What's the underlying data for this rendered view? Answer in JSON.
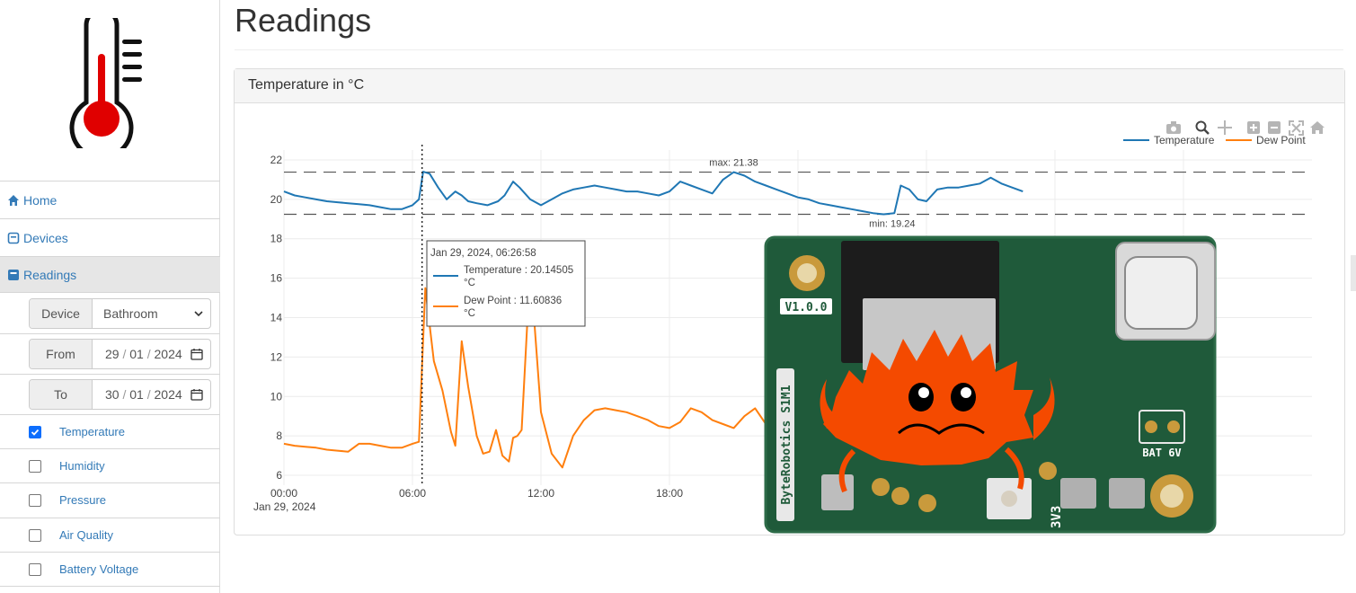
{
  "sidebar": {
    "nav": [
      {
        "label": "Home",
        "icon": "home-icon"
      },
      {
        "label": "Devices",
        "icon": "device-icon"
      },
      {
        "label": "Readings",
        "icon": "readings-icon"
      }
    ],
    "device_label": "Device",
    "device_value": "Bathroom",
    "from_label": "From",
    "from_date": {
      "day": "29",
      "month": "01",
      "year": "2024"
    },
    "to_label": "To",
    "to_date": {
      "day": "30",
      "month": "01",
      "year": "2024"
    },
    "metrics": [
      {
        "label": "Temperature",
        "checked": true
      },
      {
        "label": "Humidity",
        "checked": false
      },
      {
        "label": "Pressure",
        "checked": false
      },
      {
        "label": "Air Quality",
        "checked": false
      },
      {
        "label": "Battery Voltage",
        "checked": false
      }
    ]
  },
  "page": {
    "title": "Readings",
    "panel_title": "Temperature in °C"
  },
  "colors": {
    "temperature": "#1f77b4",
    "dew_point": "#ff7f0e",
    "link": "#337ab7",
    "thermo_red": "#e00000"
  },
  "tooltip": {
    "time": "Jan 29, 2024, 06:26:58",
    "temp_line1": "Temperature : 20.14505",
    "temp_line2": "°C",
    "dew_line1": "Dew Point : 11.60836",
    "dew_line2": "°C"
  },
  "chart_data": {
    "type": "line",
    "title": "",
    "xlabel": "",
    "ylabel": "",
    "ylim": [
      5.5,
      22.5
    ],
    "y_ticks": [
      "22",
      "20",
      "18",
      "16",
      "14",
      "12",
      "10",
      "8",
      "6"
    ],
    "x_ticks": [
      "00:00",
      "06:00",
      "12:00",
      "18:00"
    ],
    "x_date_label": "Jan 29, 2024",
    "legend": [
      "Temperature",
      "Dew Point"
    ],
    "legend_position": "top-right",
    "annotations": {
      "max_label": "max: 21.38",
      "min_label": "min: 19.24",
      "max": 21.38,
      "min": 19.24
    },
    "hover_x_hours": 6.45,
    "series": [
      {
        "name": "Temperature",
        "x_hours": [
          0,
          0.5,
          1,
          1.5,
          2,
          2.5,
          3,
          3.5,
          4,
          4.5,
          5,
          5.5,
          6,
          6.3,
          6.5,
          6.8,
          7.2,
          7.6,
          8,
          8.3,
          8.6,
          9,
          9.5,
          10,
          10.3,
          10.7,
          11,
          11.5,
          12,
          12.5,
          13,
          13.5,
          14,
          14.5,
          15,
          15.5,
          16,
          16.5,
          17,
          17.5,
          18,
          18.5,
          19,
          19.5,
          20,
          20.5,
          21,
          21.5,
          22,
          22.5,
          23,
          23.5,
          24,
          24.5,
          25,
          25.5,
          26,
          26.5,
          27,
          27.5,
          28,
          28.5,
          28.8,
          29.2,
          29.6,
          30,
          30.5,
          31,
          31.5,
          32,
          32.5,
          33,
          33.5,
          34,
          34.5
        ],
        "values": [
          20.4,
          20.2,
          20.1,
          20.0,
          19.9,
          19.85,
          19.8,
          19.75,
          19.7,
          19.6,
          19.5,
          19.5,
          19.7,
          20.0,
          21.4,
          21.3,
          20.6,
          20.0,
          20.4,
          20.2,
          19.9,
          19.8,
          19.7,
          19.9,
          20.2,
          20.9,
          20.6,
          20.0,
          19.7,
          20.0,
          20.3,
          20.5,
          20.6,
          20.7,
          20.6,
          20.5,
          20.4,
          20.4,
          20.3,
          20.2,
          20.4,
          20.9,
          20.7,
          20.5,
          20.3,
          21.0,
          21.38,
          21.2,
          20.9,
          20.7,
          20.5,
          20.3,
          20.1,
          20.0,
          19.8,
          19.7,
          19.6,
          19.5,
          19.4,
          19.3,
          19.24,
          19.3,
          20.7,
          20.5,
          20.0,
          19.9,
          20.5,
          20.6,
          20.6,
          20.7,
          20.8,
          21.1,
          20.8,
          20.6,
          20.4
        ]
      },
      {
        "name": "Dew Point",
        "x_hours": [
          0,
          0.5,
          1,
          1.5,
          2,
          2.5,
          3,
          3.5,
          4,
          4.5,
          5,
          5.5,
          6,
          6.3,
          6.45,
          6.6,
          7,
          7.4,
          7.8,
          8,
          8.3,
          8.6,
          9,
          9.3,
          9.6,
          9.9,
          10.2,
          10.5,
          10.7,
          10.9,
          11.1,
          11.5,
          12,
          12.5,
          13,
          13.5,
          14,
          14.5,
          15,
          15.5,
          16,
          16.5,
          17,
          17.5,
          18,
          18.5,
          19,
          19.5,
          20,
          20.5,
          21,
          21.5,
          22,
          22.5,
          23
        ],
        "values": [
          7.6,
          7.5,
          7.45,
          7.4,
          7.3,
          7.25,
          7.2,
          7.6,
          7.6,
          7.5,
          7.4,
          7.4,
          7.6,
          7.7,
          11.6,
          15.5,
          11.8,
          10.3,
          8.2,
          7.5,
          12.8,
          10.5,
          8.0,
          7.1,
          7.2,
          8.3,
          7.0,
          6.7,
          7.9,
          8.0,
          8.3,
          16.6,
          9.2,
          7.1,
          6.4,
          8.0,
          8.8,
          9.3,
          9.4,
          9.3,
          9.2,
          9.0,
          8.8,
          8.5,
          8.4,
          8.7,
          9.4,
          9.2,
          8.8,
          8.6,
          8.4,
          9.0,
          9.4,
          8.6,
          9.5
        ]
      }
    ]
  }
}
